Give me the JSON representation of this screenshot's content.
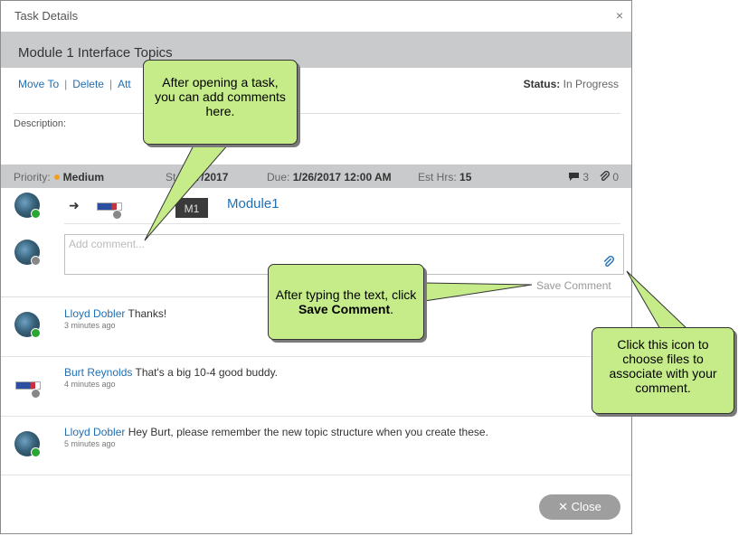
{
  "dialog": {
    "title": "Task Details",
    "close_icon": "×",
    "task_name": "Module 1 Interface Topics"
  },
  "actions": {
    "move_to": "Move To",
    "delete": "Delete",
    "attach": "Att",
    "sep": "|"
  },
  "status": {
    "label": "Status:",
    "value": "In Progress"
  },
  "description": {
    "label": "Description:"
  },
  "meta": {
    "priority_label": "Priority:",
    "priority_value": "Medium",
    "start_label": "St",
    "start_value": "/17/2017",
    "due_label": "Due:",
    "due_value": "1/26/2017 12:00 AM",
    "est_label": "Est Hrs:",
    "est_value": "15",
    "comments_count": "3",
    "attachments_count": "0"
  },
  "assignment": {
    "arrow": "➜",
    "badge": "M1",
    "module_link": "Module1"
  },
  "comment_box": {
    "placeholder": "Add comment...",
    "value": "",
    "save_label": "Save Comment"
  },
  "comments": [
    {
      "author": "Lloyd Dobler",
      "text": "Thanks!",
      "time": "3 minutes ago",
      "avatar": "photo"
    },
    {
      "author": "Burt Reynolds",
      "text": "That's a big 10-4 good buddy.",
      "time": "4 minutes ago",
      "avatar": "logo"
    },
    {
      "author": "Lloyd Dobler",
      "text": "Hey Burt, please remember the new topic structure when you create these.",
      "time": "5 minutes ago",
      "avatar": "photo"
    }
  ],
  "close_button": {
    "icon": "✕",
    "label": "Close"
  },
  "callouts": {
    "add_comment": "After opening a task, you can add comments here.",
    "save_prefix": "After typing the text, click ",
    "save_bold": "Save Comment",
    "save_suffix": ".",
    "attach": "Click this icon to choose files to associate with your comment."
  },
  "colors": {
    "accent": "#1f6fb5",
    "header_bar": "#c8cacc",
    "callout_fill": "#c6ec8a",
    "priority_dot": "#f0a020",
    "online": "#2aa632"
  }
}
